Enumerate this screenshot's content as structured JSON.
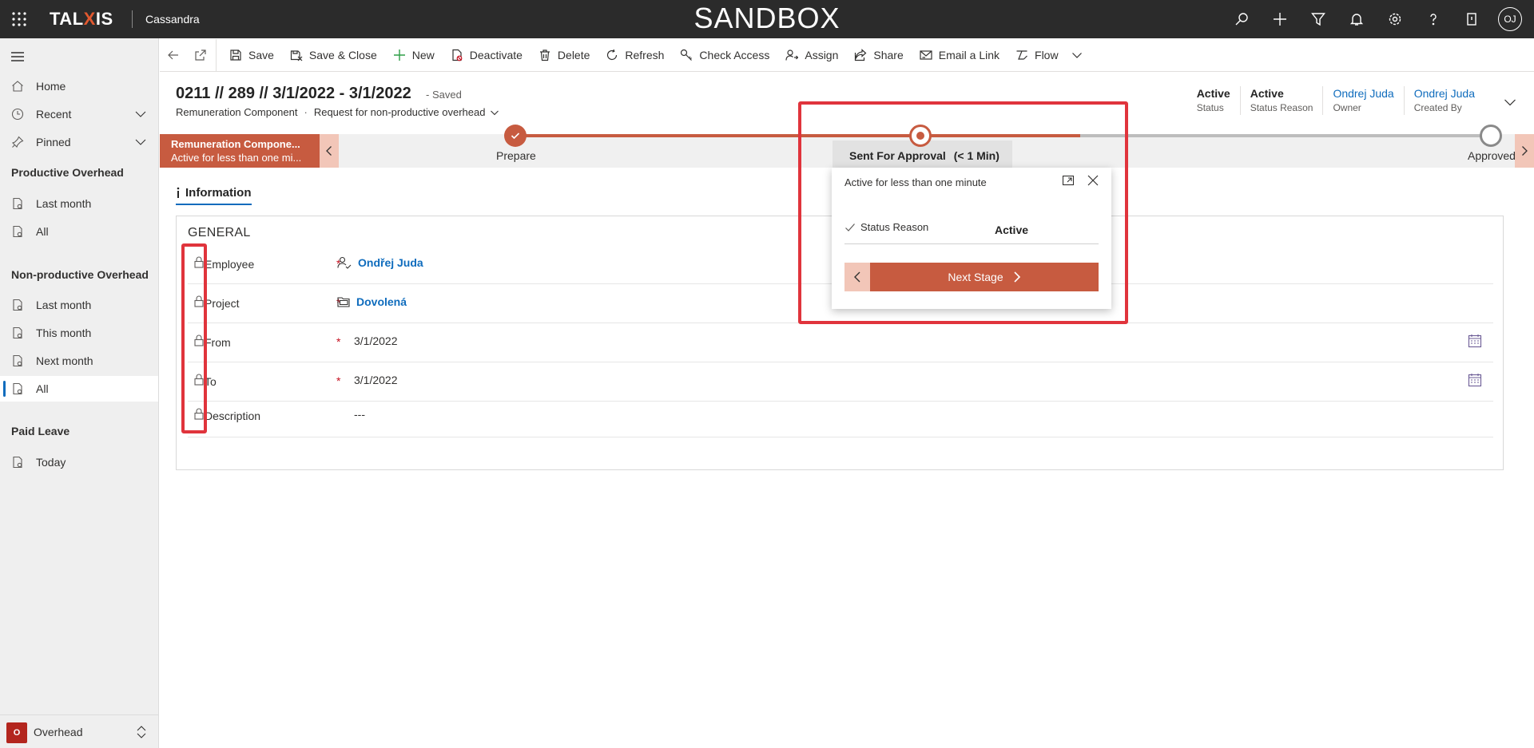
{
  "topbar": {
    "brand_pre": "TAL",
    "brand_x": "X",
    "brand_post": "IS",
    "app_name": "Cassandra",
    "environment": "SANDBOX",
    "user_initials": "OJ",
    "icons": [
      "search-icon",
      "plus-icon",
      "filter-icon",
      "bell-icon",
      "settings-icon",
      "help-icon",
      "assistant-icon",
      "avatar"
    ]
  },
  "sidebar": {
    "top_items": [
      {
        "label": "Home",
        "icon": "home-icon"
      },
      {
        "label": "Recent",
        "icon": "clock-icon"
      },
      {
        "label": "Pinned",
        "icon": "pin-icon"
      }
    ],
    "groups": [
      {
        "title": "Productive Overhead",
        "items": [
          "Last month",
          "All"
        ]
      },
      {
        "title": "Non-productive Overhead",
        "items": [
          "Last month",
          "This month",
          "Next month",
          "All"
        ],
        "selected": "All"
      },
      {
        "title": "Paid Leave",
        "items": [
          "Today"
        ]
      }
    ],
    "area": {
      "badge": "O",
      "label": "Overhead"
    }
  },
  "commands": [
    {
      "label": "Save",
      "icon": "save-icon"
    },
    {
      "label": "Save & Close",
      "icon": "save-close-icon"
    },
    {
      "label": "New",
      "icon": "plus-icon"
    },
    {
      "label": "Deactivate",
      "icon": "deactivate-icon"
    },
    {
      "label": "Delete",
      "icon": "trash-icon"
    },
    {
      "label": "Refresh",
      "icon": "refresh-icon"
    },
    {
      "label": "Check Access",
      "icon": "key-icon"
    },
    {
      "label": "Assign",
      "icon": "assign-icon"
    },
    {
      "label": "Share",
      "icon": "share-icon"
    },
    {
      "label": "Email a Link",
      "icon": "email-icon"
    },
    {
      "label": "Flow",
      "icon": "flow-icon"
    }
  ],
  "record": {
    "title": "0211 // 289 // 3/1/2022 - 3/1/2022",
    "saved": "- Saved",
    "entity": "Remuneration Component",
    "separator": "·",
    "form": "Request for non-productive overhead",
    "header_fields": [
      {
        "value": "Active",
        "label": "Status",
        "link": false
      },
      {
        "value": "Active",
        "label": "Status Reason",
        "link": false
      },
      {
        "value": "Ondrej Juda",
        "label": "Owner",
        "link": true
      },
      {
        "value": "Ondrej Juda",
        "label": "Created By",
        "link": true
      }
    ]
  },
  "bpf": {
    "active_title": "Remuneration Compone...",
    "active_sub": "Active for less than one mi...",
    "stages": [
      {
        "label": "Prepare",
        "state": "completed"
      },
      {
        "label": "Sent For Approval",
        "duration": "(< 1 Min)",
        "state": "active"
      },
      {
        "label": "Approved",
        "state": "pending"
      }
    ],
    "accent": "#c75b40"
  },
  "flyout": {
    "title": "Active for less than one minute",
    "field_label": "Status Reason",
    "field_value": "Active",
    "next_label": "Next Stage"
  },
  "form": {
    "tab": "Information",
    "section": "GENERAL",
    "fields": [
      {
        "label": "Employee",
        "required": "*",
        "value": "Ondřej Juda",
        "type": "lookup-user"
      },
      {
        "label": "Project",
        "required": "*",
        "value": "Dovolená",
        "type": "lookup-project"
      },
      {
        "label": "From",
        "required": "*",
        "value": "3/1/2022",
        "type": "date"
      },
      {
        "label": "To",
        "required": "*",
        "value": "3/1/2022",
        "type": "date"
      },
      {
        "label": "Description",
        "required": "",
        "value": "---",
        "type": "text"
      }
    ]
  },
  "annotation_color": "#e0343c"
}
